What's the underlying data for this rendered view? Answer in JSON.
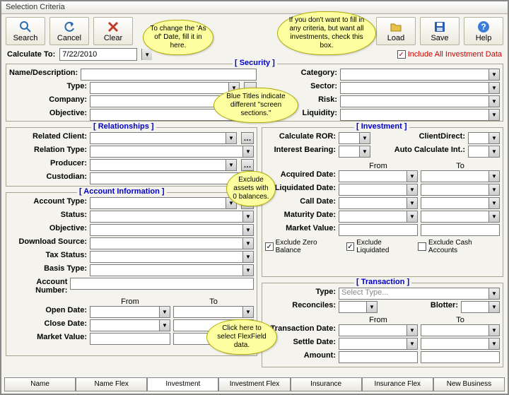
{
  "window": {
    "title": "Selection Criteria"
  },
  "toolbar": {
    "search": "Search",
    "cancel": "Cancel",
    "clear": "Clear",
    "load": "Load",
    "save": "Save",
    "help": "Help"
  },
  "calc": {
    "label": "Calculate To:",
    "date": "7/22/2010",
    "include": "Include All Investment Data"
  },
  "security": {
    "title": "[ Security ]",
    "name": "Name/Description:",
    "type": "Type:",
    "company": "Company:",
    "objective": "Objective:",
    "category": "Category:",
    "sector": "Sector:",
    "risk": "Risk:",
    "liquidity": "Liquidity:"
  },
  "relationships": {
    "title": "[ Relationships ]",
    "relatedClient": "Related Client:",
    "relationType": "Relation Type:",
    "producer": "Producer:",
    "custodian": "Custodian:"
  },
  "accountInfo": {
    "title": "[ Account Information ]",
    "accountType": "Account Type:",
    "status": "Status:",
    "objective": "Objective:",
    "downloadSource": "Download Source:",
    "taxStatus": "Tax Status:",
    "basisType": "Basis Type:",
    "accountNumber": "Account Number:",
    "from": "From",
    "to": "To",
    "openDate": "Open Date:",
    "closeDate": "Close Date:",
    "marketValue": "Market Value:"
  },
  "investment": {
    "title": "[ Investment ]",
    "calcROR": "Calculate ROR:",
    "clientDirect": "ClientDirect:",
    "interestBearing": "Interest Bearing:",
    "autoCalc": "Auto Calculate Int.:",
    "from": "From",
    "to": "To",
    "acquired": "Acquired Date:",
    "liquidated": "Liquidated Date:",
    "call": "Call Date:",
    "maturity": "Maturity Date:",
    "marketValue": "Market Value:",
    "exZero": "Exclude Zero Balance",
    "exLiq": "Exclude Liquidated",
    "exCash": "Exclude Cash Accounts"
  },
  "transaction": {
    "title": "[ Transaction ]",
    "type": "Type:",
    "typePh": "Select Type...",
    "reconciles": "Reconciles:",
    "blotter": "Blotter:",
    "from": "From",
    "to": "To",
    "txDate": "Transaction Date:",
    "settle": "Settle Date:",
    "amount": "Amount:"
  },
  "tabs": [
    "Name",
    "Name Flex",
    "Investment",
    "Investment Flex",
    "Insurance",
    "Insurance Flex",
    "New Business"
  ],
  "activeTab": 2,
  "callouts": {
    "asOf": "To change the 'As of' Date, fill it in here.",
    "incl": "If you don't want to fill in any criteria, but want all investments, check this box.",
    "blue": "Blue Titles indicate different \"screen sections.\"",
    "zero": "Exclude assets with 0 balances.",
    "flex": "Click here to select FlexField data."
  }
}
